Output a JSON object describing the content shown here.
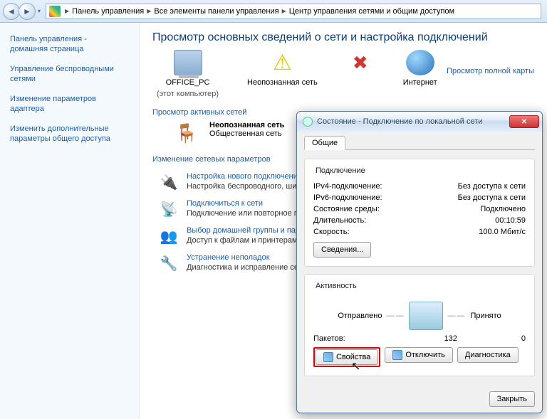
{
  "nav": {
    "crumb1": "Панель управления",
    "crumb2": "Все элементы панели управления",
    "crumb3": "Центр управления сетями и общим доступом"
  },
  "sidebar": {
    "link1a": "Панель управления -",
    "link1b": "домашняя страница",
    "link2a": "Управление беспроводными",
    "link2b": "сетями",
    "link3a": "Изменение параметров",
    "link3b": "адаптера",
    "link4a": "Изменить дополнительные",
    "link4b": "параметры общего доступа"
  },
  "main": {
    "heading": "Просмотр основных сведений о сети и настройка подключений",
    "fullmap": "Просмотр полной карты",
    "map": {
      "pc_name": "OFFICE_PC",
      "pc_sub": "(этот компьютер)",
      "net_name": "Неопознанная сеть",
      "inet_name": "Интернет"
    },
    "active_head": "Просмотр активных сетей",
    "active": {
      "name": "Неопознанная сеть",
      "kind": "Общественная сеть"
    },
    "settings_head": "Изменение сетевых параметров",
    "s1": {
      "title": "Настройка нового подключени",
      "desc": "Настройка беспроводного, шир\nили же настройка маршрутизат"
    },
    "s2": {
      "title": "Подключиться к сети",
      "desc": "Подключение или повторное по\nсетевому соединению или подк"
    },
    "s3": {
      "title": "Выбор домашней группы и пар",
      "desc": "Доступ к файлам и принтерам,\nизменение параметров общего"
    },
    "s4": {
      "title": "Устранение неполадок",
      "desc": "Диагностика и исправление сет"
    }
  },
  "dialog": {
    "title": "Состояние - Подключение по локальной сети",
    "tab": "Общие",
    "conn_group": "Подключение",
    "ipv4_label": "IPv4-подключение:",
    "ipv4_value": "Без доступа к сети",
    "ipv6_label": "IPv6-подключение:",
    "ipv6_value": "Без доступа к сети",
    "media_label": "Состояние среды:",
    "media_value": "Подключено",
    "dur_label": "Длительность:",
    "dur_value": "00:10:59",
    "speed_label": "Скорость:",
    "speed_value": "100.0 Мбит/с",
    "details_btn": "Сведения...",
    "activity_group": "Активность",
    "sent_label": "Отправлено",
    "recv_label": "Принято",
    "pkts_label": "Пакетов:",
    "pkts_sent": "132",
    "pkts_recv": "0",
    "props_btn": "Свойства",
    "disable_btn": "Отключить",
    "diag_btn": "Диагностика",
    "close_btn": "Закрыть"
  }
}
